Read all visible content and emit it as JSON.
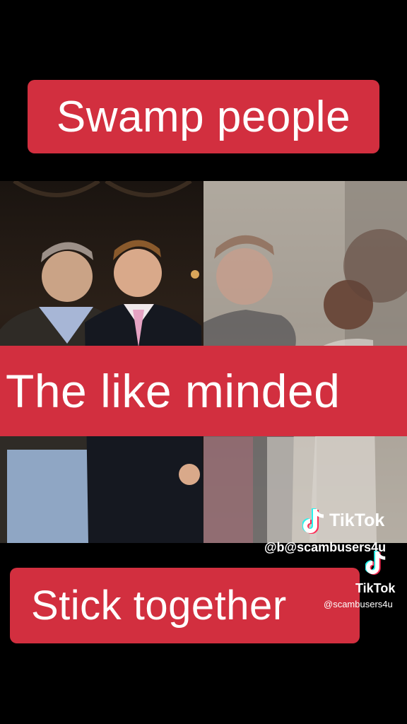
{
  "captions": {
    "top": "Swamp people",
    "middle": "The like minded",
    "bottom": "Stick together"
  },
  "watermarks": {
    "brand_1": "TikTok",
    "handle_1": "@b@scambusers4u",
    "brand_2": "TikTok",
    "handle_2": "@scambusers4u"
  },
  "colors": {
    "banner": "#d22f3f",
    "background": "#000000"
  },
  "icons": [
    "tiktok-logo-icon",
    "tiktok-logo-icon"
  ]
}
